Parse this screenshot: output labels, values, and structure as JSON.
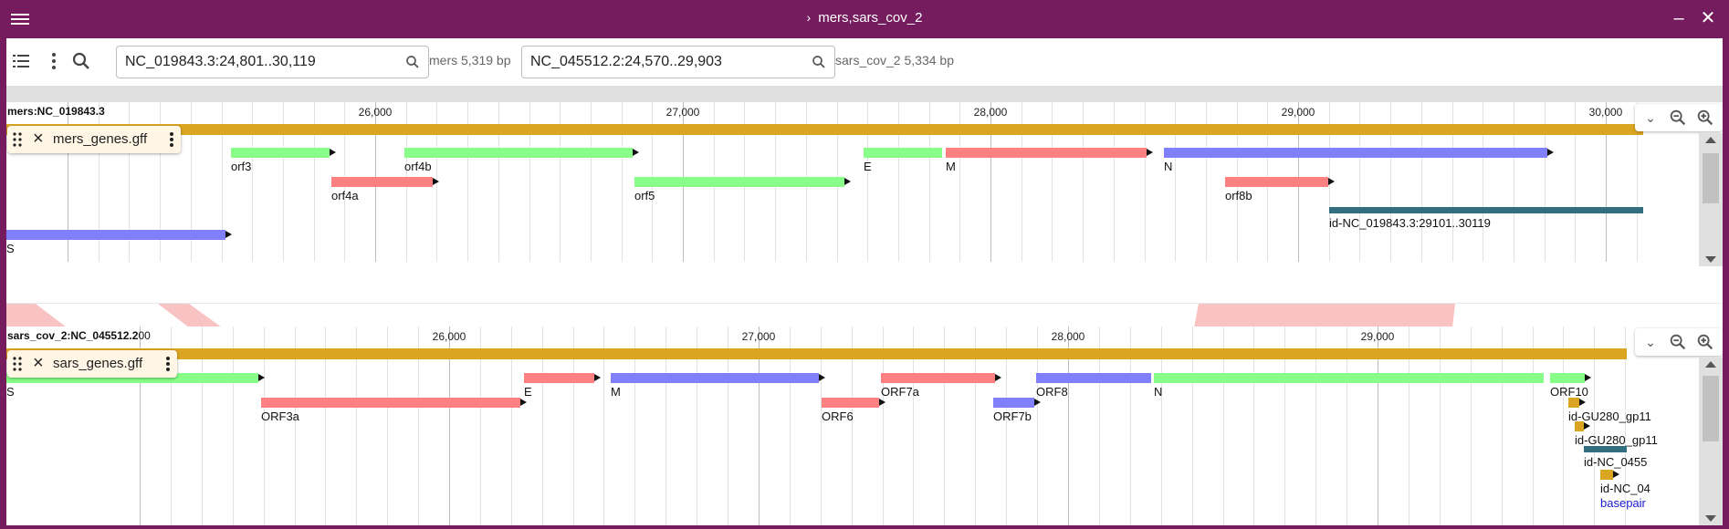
{
  "titlebar": {
    "title": "mers,sars_cov_2",
    "minimize_icon": "minimize-icon",
    "close_icon": "close-icon"
  },
  "toolbar": {
    "mers_location": "NC_019843.3:24,801..30,119",
    "mers_bp": "mers 5,319 bp",
    "sars_location": "NC_045512.2:24,570..29,903",
    "sars_bp": "sars_cov_2 5,334 bp"
  },
  "mers_view": {
    "name": "mers:NC_019843.3",
    "track_name": "mers_genes.gff",
    "ruler": [
      "26,000",
      "27,000",
      "28,000",
      "29,000",
      "30,000"
    ],
    "features": {
      "orf3": "orf3",
      "orf4a": "orf4a",
      "orf4b": "orf4b",
      "orf5": "orf5",
      "E": "E",
      "M": "M",
      "N": "N",
      "orf8b": "orf8b",
      "region": "id-NC_019843.3:29101..30119",
      "S": "S"
    }
  },
  "sars_view": {
    "name": "sars_cov_2:NC_045512.2",
    "name_suffix": "00",
    "track_name": "sars_genes.gff",
    "ruler": [
      "26,000",
      "27,000",
      "28,000",
      "29,000"
    ],
    "features": {
      "S": "S",
      "ORF3a": "ORF3a",
      "E": "E",
      "M": "M",
      "ORF6": "ORF6",
      "ORF7a": "ORF7a",
      "ORF7b": "ORF7b",
      "ORF8": "ORF8",
      "N": "N",
      "ORF10": "ORF10",
      "gp11a": "id-GU280_gp11",
      "gp11b": "id-GU280_gp11",
      "nc1": "id-NC_0455",
      "nc2": "id-NC_04",
      "basepair": "basepair"
    }
  },
  "colors": {
    "frame": "#741c5e",
    "green": "#88ff88",
    "red": "#ff8080",
    "blue": "#8080ff",
    "teal": "#336e80",
    "gold": "#daa520",
    "synteny": "#f8b8b8"
  }
}
